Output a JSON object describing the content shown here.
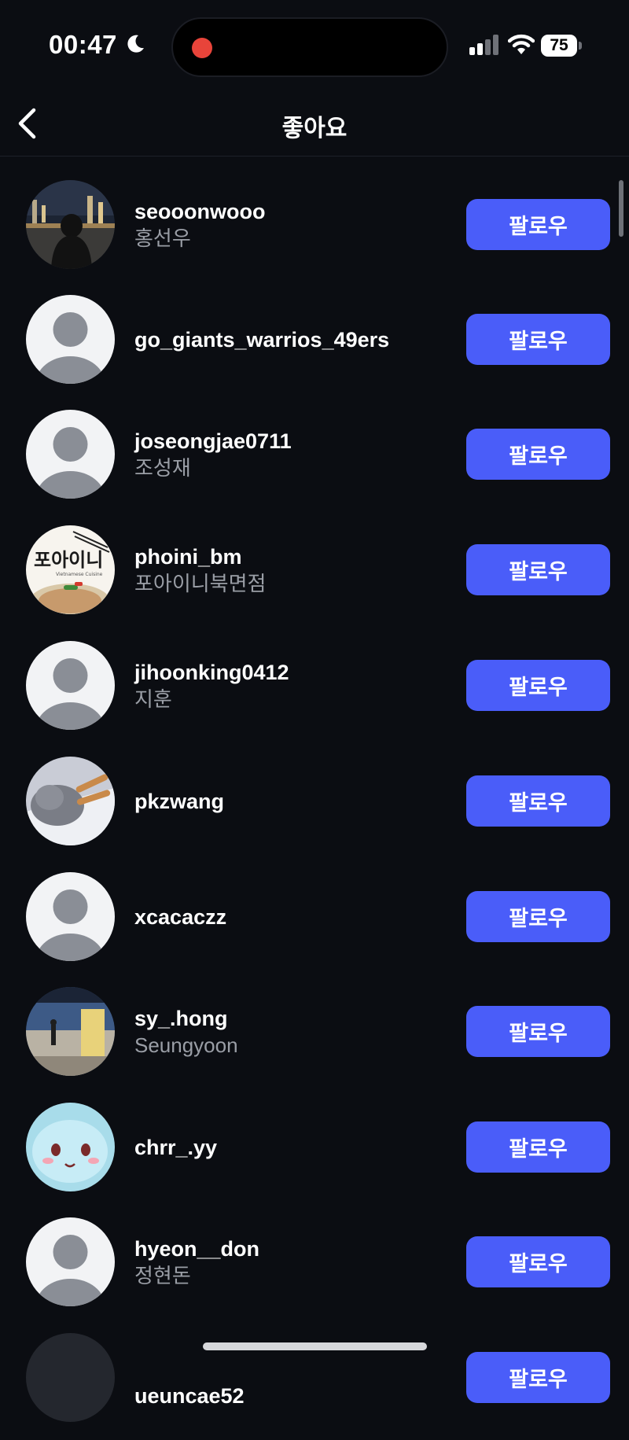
{
  "status_bar": {
    "time": "00:47",
    "battery": "75"
  },
  "header": {
    "title": "좋아요"
  },
  "list": [
    {
      "username": "seooonwooo",
      "fullname": "홍선우",
      "avatar": "photo-night-city",
      "button": "팔로우"
    },
    {
      "username": "go_giants_warrios_49ers",
      "fullname": "",
      "avatar": "default",
      "button": "팔로우"
    },
    {
      "username": "joseongjae0711",
      "fullname": "조성재",
      "avatar": "default",
      "button": "팔로우"
    },
    {
      "username": "phoini_bm",
      "fullname": "포아이니북면점",
      "avatar": "photo-restaurant-logo",
      "logo_text": "포아이니",
      "logo_subtext": "Vietnamese Cuisine",
      "button": "팔로우"
    },
    {
      "username": "jihoonking0412",
      "fullname": "지훈",
      "avatar": "default",
      "button": "팔로우"
    },
    {
      "username": "pkzwang",
      "fullname": "",
      "avatar": "photo-cat",
      "button": "팔로우"
    },
    {
      "username": "xcacaczz",
      "fullname": "",
      "avatar": "default",
      "button": "팔로우"
    },
    {
      "username": "sy_.hong",
      "fullname": "Seungyoon",
      "avatar": "photo-terrace",
      "button": "팔로우"
    },
    {
      "username": "chrr_.yy",
      "fullname": "",
      "avatar": "photo-cartoon",
      "button": "팔로우"
    },
    {
      "username": "hyeon__don",
      "fullname": "정현돈",
      "avatar": "default",
      "button": "팔로우"
    },
    {
      "username": "ueuncae52",
      "fullname": "",
      "avatar": "default-dark",
      "button": "팔로우"
    }
  ],
  "colors": {
    "background": "#0b0d12",
    "follow_button": "#4a5df9",
    "secondary_text": "#9a9ea6"
  }
}
